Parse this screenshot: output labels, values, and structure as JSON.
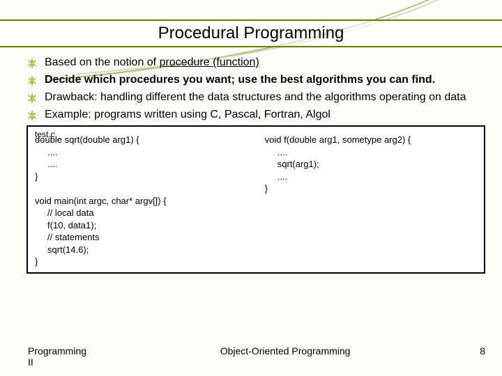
{
  "title": "Procedural Programming",
  "bullets": [
    {
      "prefix": "Based on the notion of ",
      "underlined": "procedure (function)",
      "suffix": ""
    },
    {
      "bold": "Decide which procedures you want; use the best algorithms you can find."
    },
    {
      "plain": "Drawback: handling different the data structures and the algorithms operating on data"
    },
    {
      "plain": "Example: programs written using C, Pascal, Fortran, Algol"
    }
  ],
  "code_box": {
    "label": "test.c",
    "left": "double sqrt(double arg1) {\n     ....\n     ....\n}\n\nvoid main(int argc, char* argv[]) {\n     // local data\n     f(10, data1);\n     // statements\n     sqrt(14.6);\n}",
    "right": "void f(double arg1, sometype arg2) {\n     ....\n     sqrt(arg1);\n     ....\n}"
  },
  "footer": {
    "left": "Programming II",
    "center": "Object-Oriented Programming",
    "right": "8"
  }
}
